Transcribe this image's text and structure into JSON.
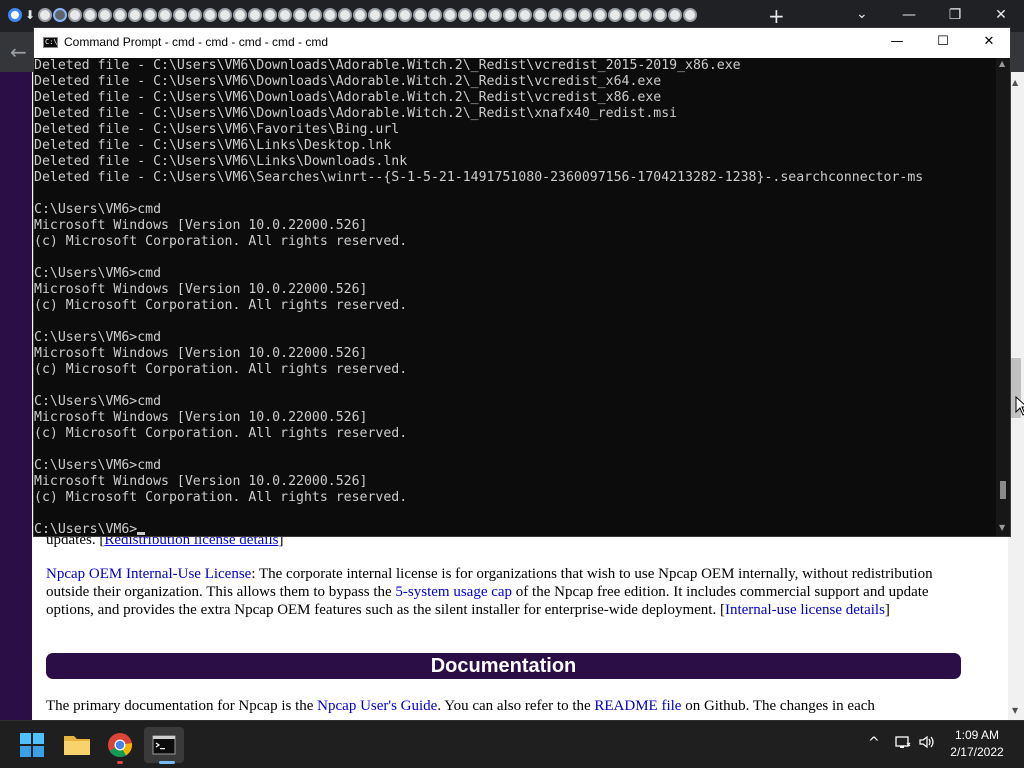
{
  "browser": {
    "tab_favicon_count": 46,
    "new_tab": "+",
    "tab_search": "⌄",
    "minimize": "—",
    "restore": "❐",
    "close": "✕",
    "back": "←"
  },
  "cmd": {
    "title": "Command Prompt - cmd - cmd - cmd - cmd - cmd",
    "icon_text": "C:\\",
    "minimize": "—",
    "maximize": "☐",
    "close": "✕",
    "lines": [
      "Deleted file - C:\\Users\\VM6\\Downloads\\Adorable.Witch.2\\_Redist\\vcredist_2015-2019_x86.exe",
      "Deleted file - C:\\Users\\VM6\\Downloads\\Adorable.Witch.2\\_Redist\\vcredist_x64.exe",
      "Deleted file - C:\\Users\\VM6\\Downloads\\Adorable.Witch.2\\_Redist\\vcredist_x86.exe",
      "Deleted file - C:\\Users\\VM6\\Downloads\\Adorable.Witch.2\\_Redist\\xnafx40_redist.msi",
      "Deleted file - C:\\Users\\VM6\\Favorites\\Bing.url",
      "Deleted file - C:\\Users\\VM6\\Links\\Desktop.lnk",
      "Deleted file - C:\\Users\\VM6\\Links\\Downloads.lnk",
      "Deleted file - C:\\Users\\VM6\\Searches\\winrt--{S-1-5-21-1491751080-2360097156-1704213282-1238}-.searchconnector-ms",
      "",
      "C:\\Users\\VM6>cmd",
      "Microsoft Windows [Version 10.0.22000.526]",
      "(c) Microsoft Corporation. All rights reserved.",
      "",
      "C:\\Users\\VM6>cmd",
      "Microsoft Windows [Version 10.0.22000.526]",
      "(c) Microsoft Corporation. All rights reserved.",
      "",
      "C:\\Users\\VM6>cmd",
      "Microsoft Windows [Version 10.0.22000.526]",
      "(c) Microsoft Corporation. All rights reserved.",
      "",
      "C:\\Users\\VM6>cmd",
      "Microsoft Windows [Version 10.0.22000.526]",
      "(c) Microsoft Corporation. All rights reserved.",
      "",
      "C:\\Users\\VM6>cmd",
      "Microsoft Windows [Version 10.0.22000.526]",
      "(c) Microsoft Corporation. All rights reserved.",
      ""
    ],
    "prompt": "C:\\Users\\VM6>"
  },
  "page": {
    "partial_line_text": "updates. [",
    "partial_line_link": "Redistribution license details",
    "partial_line_end": "]",
    "oem_link": "Npcap OEM Internal-Use License",
    "oem_text_1": ": The corporate internal license is for organizations that wish to use Npcap OEM internally, without redistribution outside their organization. This allows them to bypass the ",
    "oem_link_2": "5-system usage cap",
    "oem_text_2": " of the Npcap free edition. It includes commercial support and update options, and provides the extra Npcap OEM features such as the silent installer for enterprise-wide deployment. [",
    "oem_link_3": "Internal-use license details",
    "oem_text_3": "]",
    "doc_heading": "Documentation",
    "doc_text_1": "The primary documentation for Npcap is the ",
    "doc_link_1": "Npcap User's Guide",
    "doc_text_2": ". You can also refer to the ",
    "doc_link_2": "README file",
    "doc_text_3": " on Github. The changes in each"
  },
  "taskbar": {
    "start_icon": "windows-start-icon",
    "explorer_icon": "file-explorer-icon",
    "chrome_icon": "chrome-icon",
    "cmd_icon": "command-prompt-icon",
    "tray_chevron": "^",
    "time": "1:09 AM",
    "date": "2/17/2022"
  }
}
